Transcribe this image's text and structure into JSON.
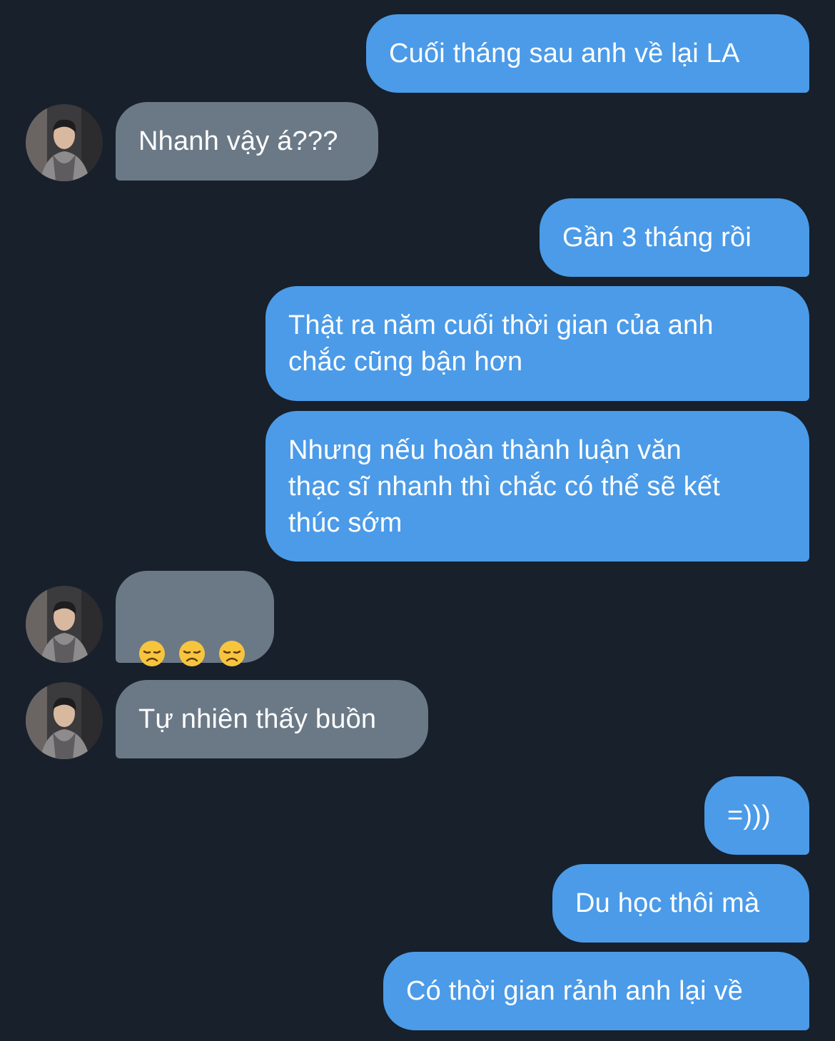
{
  "messages": [
    {
      "side": "out",
      "text": "Cuối tháng sau anh về lại LA"
    },
    {
      "side": "in",
      "text": "Nhanh vậy á???",
      "avatar": true
    },
    {
      "side": "out",
      "text": "Gần 3 tháng rồi"
    },
    {
      "side": "out",
      "text": "Thật ra năm cuối thời gian của anh\nchắc cũng bận hơn"
    },
    {
      "side": "out",
      "text": "Nhưng nếu hoàn thành luận văn\nthạc sĩ nhanh thì chắc có thể sẽ kết\nthúc sớm"
    },
    {
      "side": "in",
      "emoji": [
        "disappointed-face-icon",
        "disappointed-face-icon",
        "disappointed-face-icon"
      ],
      "avatar": true
    },
    {
      "side": "in",
      "text": "Tự nhiên thấy buồn",
      "avatar": true
    },
    {
      "side": "out",
      "text": "=)))"
    },
    {
      "side": "out",
      "text": "Du học thôi mà"
    },
    {
      "side": "out",
      "text": "Có thời gian rảnh anh lại về"
    }
  ],
  "colors": {
    "background": "#17202b",
    "outgoing_bubble": "#4b9be8",
    "incoming_bubble": "#6b7987",
    "text": "#ffffff"
  }
}
